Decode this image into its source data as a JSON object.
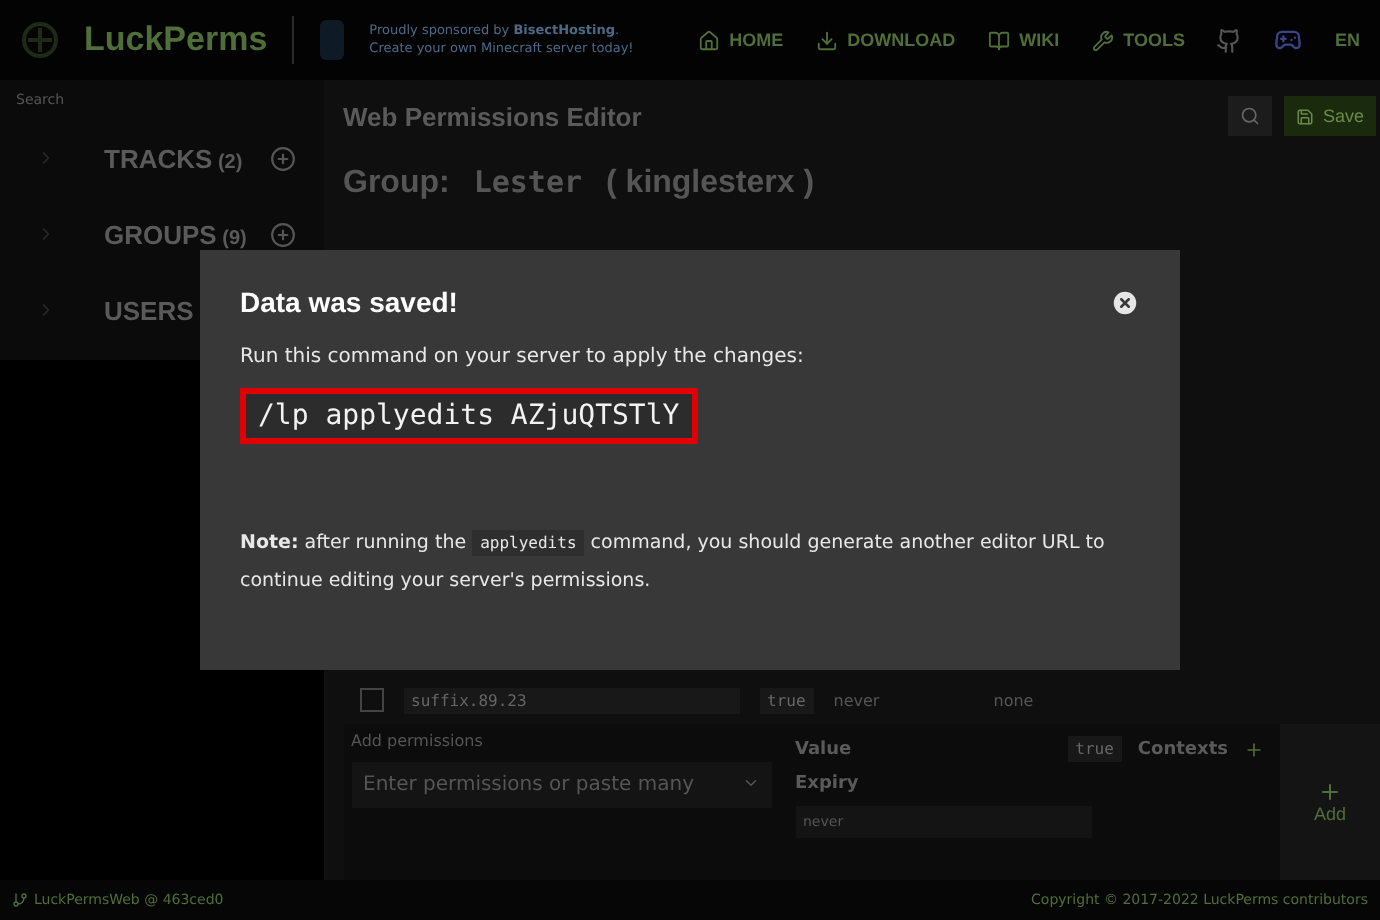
{
  "header": {
    "logo": "LuckPerms",
    "sponsor_line_1": "Proudly sponsored by **BisectHosting**.",
    "sponsor_line_2": "Create your own Minecraft server today!",
    "nav": [
      {
        "label": "HOME"
      },
      {
        "label": "DOWNLOAD"
      },
      {
        "label": "WIKI"
      },
      {
        "label": "TOOLS"
      }
    ],
    "language": "EN"
  },
  "sidebar": {
    "search": "Search",
    "sections": [
      {
        "label": "TRACKS",
        "count": "(2)",
        "expanded": false
      },
      {
        "label": "GROUPS",
        "count": "(9)",
        "expanded": false
      },
      {
        "label": "USERS",
        "expanded": false
      }
    ]
  },
  "editor": {
    "title": "Web Permissions Editor",
    "save": "Save",
    "group_label": "Group:",
    "group_name": "Lester",
    "group_display": "( kinglesterx )",
    "rows": [
      {
        "node": "suffix.89.23",
        "value": "true",
        "expiry": "never",
        "contexts": "none",
        "checked": false
      }
    ],
    "add": {
      "title": "Add permissions",
      "placeholder": "Enter permissions or paste many",
      "value_label": "Value",
      "value": "true",
      "contexts_label": "Contexts",
      "expiry_label": "Expiry",
      "expiry_placeholder": "never",
      "button": "Add"
    }
  },
  "modal": {
    "title": "Data was saved!",
    "instruction": "Run this command on your server to apply the changes:",
    "command": "/lp applyedits AZjuQTSTlY",
    "note_label": "Note:",
    "note_before": "after running the",
    "note_code": "applyedits",
    "note_after": "command, you should generate another editor URL to continue editing your server's permissions."
  },
  "footer": {
    "version": "LuckPermsWeb @ 463ced0",
    "copyright": "Copyright © 2017-2022 LuckPerms contributors"
  }
}
